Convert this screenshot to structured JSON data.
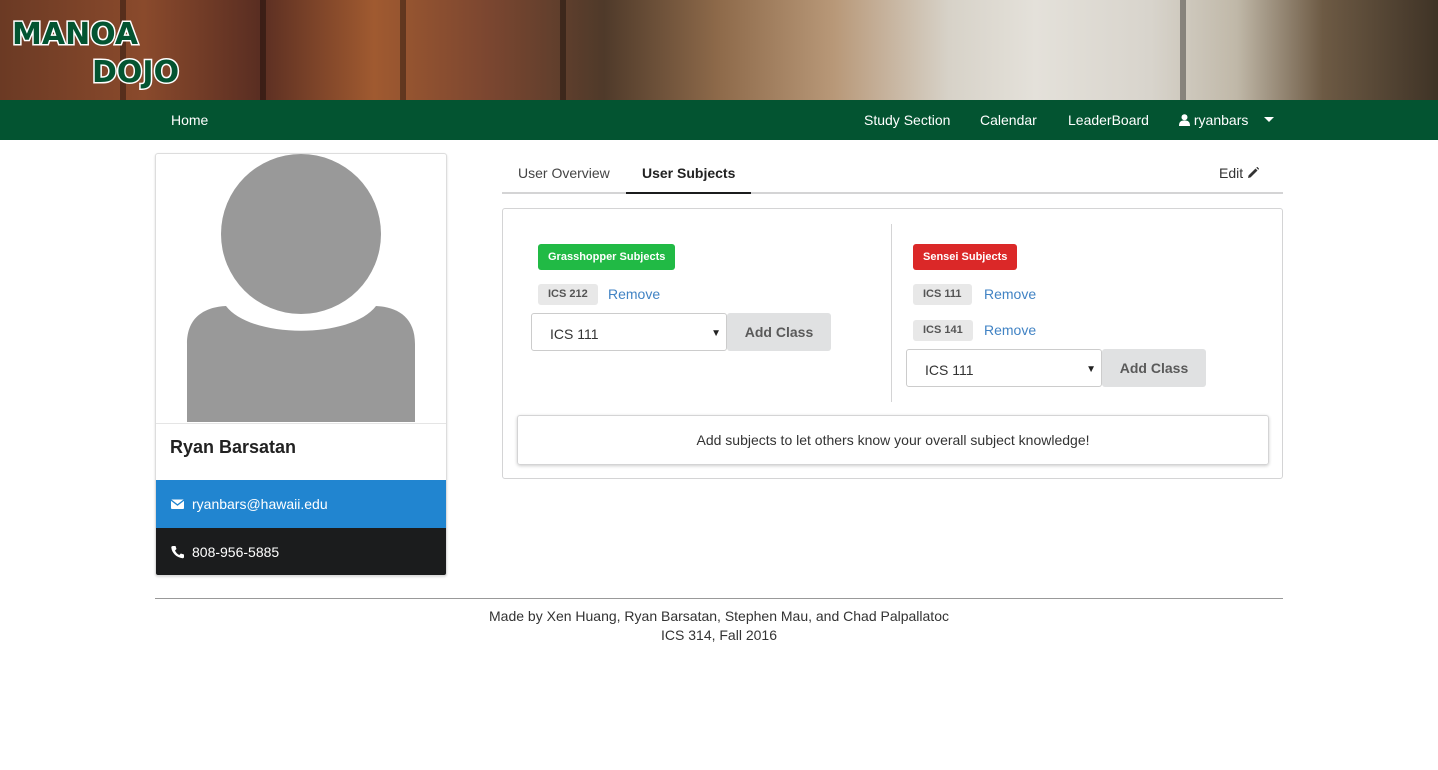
{
  "colors": {
    "nav_bg": "#035431",
    "grasshopper": "#21ba45",
    "sensei": "#db2828",
    "email_row": "#2185d0",
    "phone_row": "#1b1c1d",
    "link": "#4183c4"
  },
  "brand": {
    "logo_text_line1": "MANOA",
    "logo_text_line2": "DOJO"
  },
  "nav": {
    "home": "Home",
    "study_section": "Study Section",
    "calendar": "Calendar",
    "leaderboard": "LeaderBoard",
    "user": "ryanbars",
    "user_icon": "user-icon",
    "dropdown_icon": "caret-down-icon"
  },
  "profile": {
    "name": "Ryan Barsatan",
    "email": "ryanbars@hawaii.edu",
    "phone": "808-956-5885",
    "email_icon": "envelope-icon",
    "phone_icon": "phone-icon"
  },
  "tabs": {
    "overview": "User Overview",
    "subjects": "User Subjects",
    "active": "User Subjects",
    "edit": "Edit"
  },
  "grasshopper": {
    "label": "Grasshopper Subjects",
    "courses": [
      "ICS 212"
    ],
    "remove": "Remove",
    "select_value": "ICS 111",
    "add_button": "Add Class"
  },
  "sensei": {
    "label": "Sensei Subjects",
    "courses": [
      "ICS 111",
      "ICS 141"
    ],
    "remove": "Remove",
    "select_value": "ICS 111",
    "add_button": "Add Class"
  },
  "info": "Add subjects to let others know your overall subject knowledge!",
  "footer": {
    "line1": "Made by Xen Huang, Ryan Barsatan, Stephen Mau, and Chad Palpallatoc",
    "line2": "ICS 314, Fall 2016"
  }
}
